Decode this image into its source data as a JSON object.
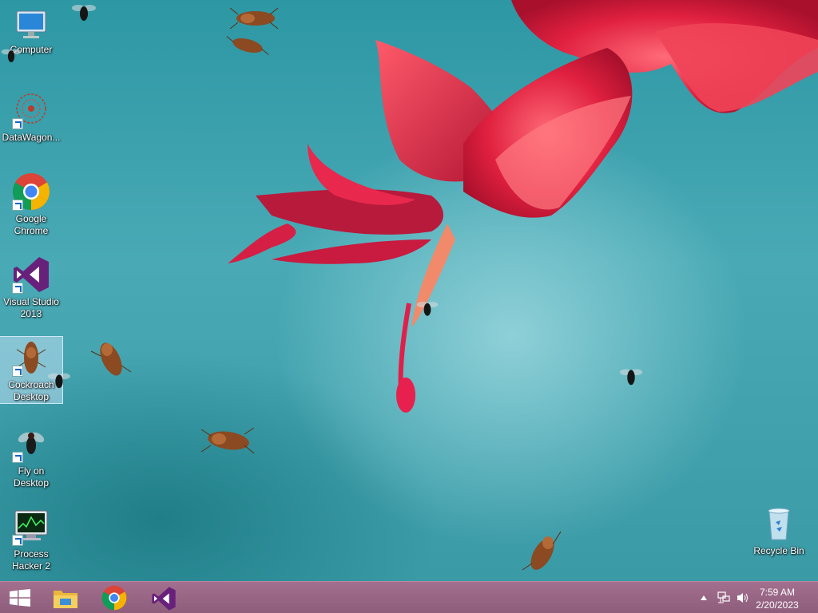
{
  "desktop": {
    "icons": [
      {
        "name": "computer-icon",
        "label": "Computer"
      },
      {
        "name": "datawagon-icon",
        "label": "DataWagon..."
      },
      {
        "name": "chrome-icon",
        "label": "Google Chrome"
      },
      {
        "name": "visual-studio-icon",
        "label": "Visual Studio 2013"
      },
      {
        "name": "cockroach-icon",
        "label": "Cockroach Desktop"
      },
      {
        "name": "fly-icon",
        "label": "Fly on Desktop"
      },
      {
        "name": "process-hacker-icon",
        "label": "Process Hacker 2"
      }
    ],
    "recycle_bin": {
      "label": "Recycle Bin"
    }
  },
  "taskbar": {
    "pinned": [
      "windows-start-icon",
      "file-explorer-icon",
      "chrome-icon",
      "visual-studio-icon"
    ],
    "tray": {
      "time": "7:59 AM",
      "date": "2/20/2023"
    }
  },
  "colors": {
    "taskbar": "#8d5d7b",
    "wallpaper": "#3a9aa6",
    "flower": "#d6214a"
  }
}
